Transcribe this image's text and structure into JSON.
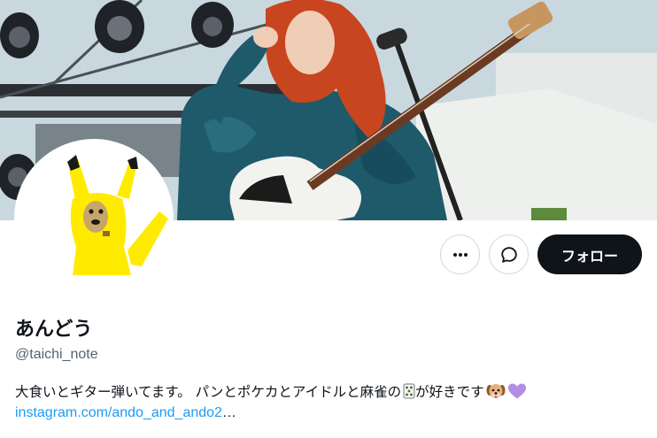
{
  "profile": {
    "display_name": "あんどう",
    "handle": "@taichi_note",
    "bio_text": "大食いとギター弾いてます。 パンとポケカとアイドルと麻雀の",
    "bio_suffix": "が好きです",
    "bio_emojis": [
      "mahjong-tile-icon",
      "dog-face-icon",
      "purple-heart-icon"
    ],
    "link_text": "instagram.com/ando_and_ando2",
    "link_ellipsis": "…"
  },
  "actions": {
    "more_icon": "more-icon",
    "message_icon": "message-icon",
    "follow_label": "フォロー"
  },
  "colors": {
    "follow_bg": "#0f1419",
    "link": "#1d9bf0",
    "handle": "#536471",
    "avatar_yellow": "#ffeb00"
  }
}
